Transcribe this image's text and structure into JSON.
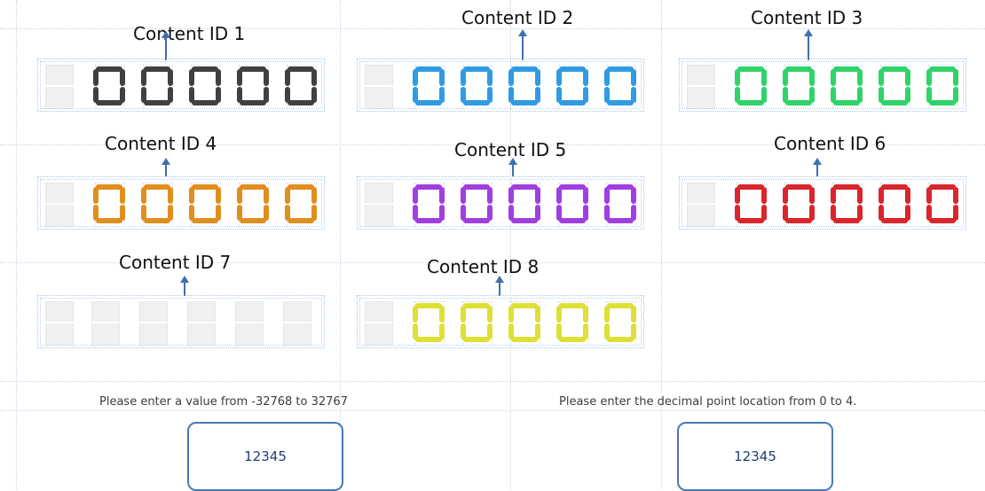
{
  "displays": [
    {
      "caption": "Content ID 1",
      "color": "#404040",
      "show_value": true
    },
    {
      "caption": "Content ID 2",
      "color": "#2f9be3",
      "show_value": true
    },
    {
      "caption": "Content ID 3",
      "color": "#2fd468",
      "show_value": true
    },
    {
      "caption": "Content ID 4",
      "color": "#e08f1e",
      "show_value": true
    },
    {
      "caption": "Content ID 5",
      "color": "#a13ee0",
      "show_value": true
    },
    {
      "caption": "Content ID 6",
      "color": "#d9262b",
      "show_value": true
    },
    {
      "caption": "Content ID 7",
      "color": "#e2e2e2",
      "show_value": false
    },
    {
      "caption": "Content ID 8",
      "color": "#dde035",
      "show_value": true
    }
  ],
  "value_input": {
    "prompt": "Please enter a value from -32768 to 32767",
    "value": "12345"
  },
  "decimal_input": {
    "prompt": "Please enter the decimal point location from 0 to 4.",
    "value": "12345"
  }
}
